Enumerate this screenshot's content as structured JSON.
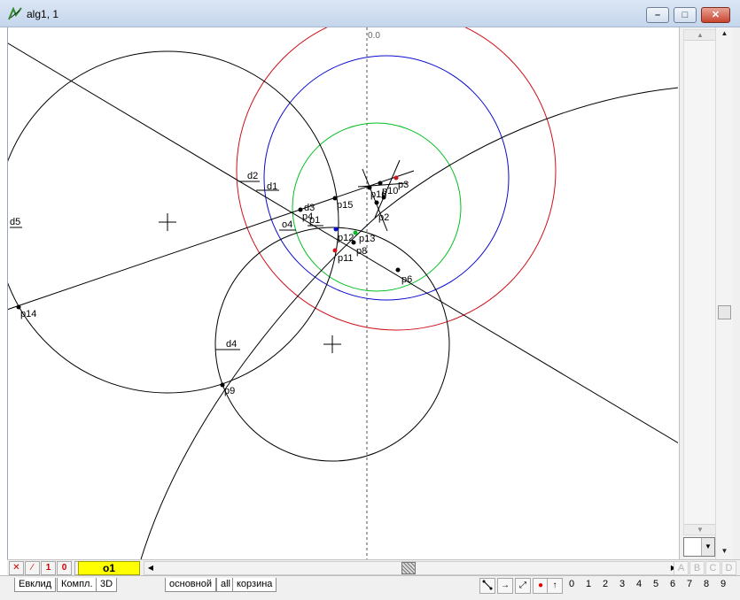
{
  "window": {
    "title": "alg1, 1",
    "minimize": "–",
    "maximize": "□",
    "close": "✕"
  },
  "canvas": {
    "axis_label": "0.0",
    "labels": {
      "d1": "d1",
      "d2": "d2",
      "d3": "d3",
      "d4": "d4",
      "d5": "d5",
      "o4": "o4",
      "p1": "p1",
      "p2": "p2",
      "p3": "p3",
      "p4": "p4",
      "p6": "p6",
      "p8": "p8",
      "p9": "p9",
      "p10": "p10",
      "p11": "p11",
      "p12": "p12",
      "p13": "p13",
      "p14": "p14",
      "p15": "p15",
      "p16": "p16"
    },
    "colors": {
      "red_circle": "#d0101a",
      "blue_circle": "#0a0ad0",
      "green_circle": "#00c020",
      "black": "#000000"
    }
  },
  "toolbar_top": {
    "btn_x": "✕",
    "btn_slash": "∕",
    "btn_1": "1",
    "btn_0": "0",
    "counter": "0",
    "current": "o1",
    "abcd": [
      "A",
      "B",
      "C",
      "D"
    ]
  },
  "toolbar_bottom": {
    "tabs": [
      "Евклид",
      "Компл.",
      "3D"
    ],
    "tabs2": [
      "основной",
      "all",
      "корзина"
    ],
    "digits": [
      "0",
      "1",
      "2",
      "3",
      "4",
      "5",
      "6",
      "7",
      "8",
      "9"
    ]
  }
}
